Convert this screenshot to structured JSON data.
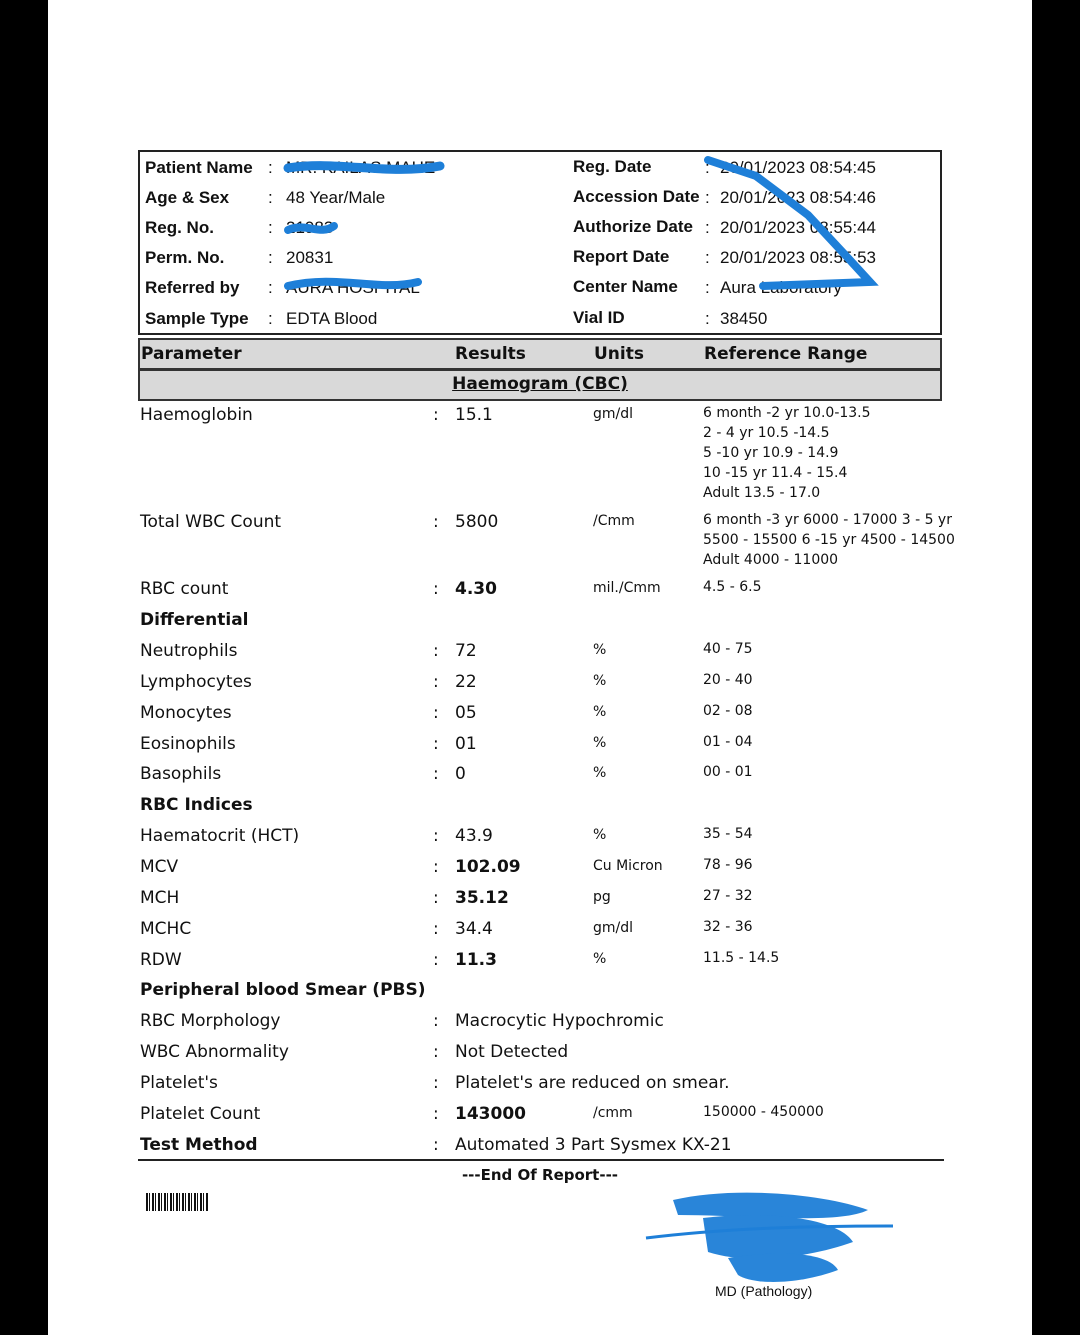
{
  "patient": {
    "left": [
      {
        "label": "Patient Name",
        "value": "MR. KAILAS MAHE"
      },
      {
        "label": "Age & Sex",
        "value": "48 Year/Male"
      },
      {
        "label": "Reg. No.",
        "value": "21983"
      },
      {
        "label": "Perm. No.",
        "value": "20831"
      },
      {
        "label": "Referred by",
        "value": "AURA HOSPITAL"
      },
      {
        "label": "Sample Type",
        "value": "EDTA Blood"
      }
    ],
    "right": [
      {
        "label": "Reg. Date",
        "value": "20/01/2023 08:54:45"
      },
      {
        "label": "Accession Date",
        "value": "20/01/2023 08:54:46"
      },
      {
        "label": "Authorize Date",
        "value": "20/01/2023 08:55:44"
      },
      {
        "label": "Report Date",
        "value": "20/01/2023 08:55:53"
      },
      {
        "label": "Center Name",
        "value": "Aura Laboratory"
      },
      {
        "label": "Vial ID",
        "value": "38450"
      }
    ]
  },
  "table_header": {
    "parameter": "Parameter",
    "results": "Results",
    "units": "Units",
    "reference": "Reference Range"
  },
  "section_title": "Haemogram (CBC)",
  "rows": [
    {
      "name": "Haemoglobin",
      "result": "15.1",
      "unit": "gm/dl",
      "ref": [
        "6 month -2 yr 10.0-13.5",
        "2 - 4 yr 10.5 -14.5",
        "5 -10 yr 10.9 - 14.9",
        "10 -15 yr 11.4 - 15.4",
        "Adult 13.5 - 17.0"
      ]
    },
    {
      "name": "Total WBC Count",
      "result": "5800",
      "unit": "/Cmm",
      "ref": [
        "6 month -3 yr 6000 - 17000 3 - 5 yr",
        "5500 - 15500 6 -15 yr 4500 - 14500",
        "Adult 4000 - 11000"
      ]
    },
    {
      "name": "RBC count",
      "result": "4.30",
      "unit": "mil./Cmm",
      "ref": [
        "4.5 - 6.5"
      ]
    },
    {
      "heading": "Differential"
    },
    {
      "name": "Neutrophils",
      "result": "72",
      "unit": "%",
      "ref": [
        "40 - 75"
      ]
    },
    {
      "name": "Lymphocytes",
      "result": "22",
      "unit": "%",
      "ref": [
        "20 - 40"
      ]
    },
    {
      "name": "Monocytes",
      "result": "05",
      "unit": "%",
      "ref": [
        "02 - 08"
      ]
    },
    {
      "name": "Eosinophils",
      "result": "01",
      "unit": "%",
      "ref": [
        "01 - 04"
      ]
    },
    {
      "name": "Basophils",
      "result": "0",
      "unit": "%",
      "ref": [
        "00 - 01"
      ]
    },
    {
      "heading": "RBC Indices"
    },
    {
      "name": "Haematocrit (HCT)",
      "result": "43.9",
      "unit": "%",
      "ref": [
        "35 - 54"
      ]
    },
    {
      "name": "MCV",
      "result": "102.09",
      "unit": "Cu Micron",
      "ref": [
        "78 - 96"
      ]
    },
    {
      "name": "MCH",
      "result": "35.12",
      "unit": "pg",
      "ref": [
        "27 - 32"
      ]
    },
    {
      "name": "MCHC",
      "result": "34.4",
      "unit": "gm/dl",
      "ref": [
        "32 - 36"
      ]
    },
    {
      "name": "RDW",
      "result": "11.3",
      "unit": "%",
      "ref": [
        "11.5 - 14.5"
      ]
    },
    {
      "heading": "Peripheral blood Smear (PBS)"
    },
    {
      "name": "RBC Morphology",
      "result": "Macrocytic Hypochromic",
      "unit": "",
      "ref": []
    },
    {
      "name": "WBC Abnormality",
      "result": "Not Detected",
      "unit": "",
      "ref": []
    },
    {
      "name": "Platelet's",
      "result": "Platelet's are reduced on smear.",
      "unit": "",
      "ref": []
    },
    {
      "name": "Platelet Count",
      "result": "143000",
      "unit": "/cmm",
      "ref": [
        "150000 - 450000"
      ]
    },
    {
      "name": "Test Method",
      "result": "Automated 3 Part Sysmex KX-21",
      "unit": "",
      "ref": []
    }
  ],
  "end_text": "---End Of Report---",
  "signature": {
    "qualification": "MD (Pathology)"
  },
  "colors": {
    "redaction": "#1e7fd8",
    "header_bar": "#d9d9d9"
  }
}
